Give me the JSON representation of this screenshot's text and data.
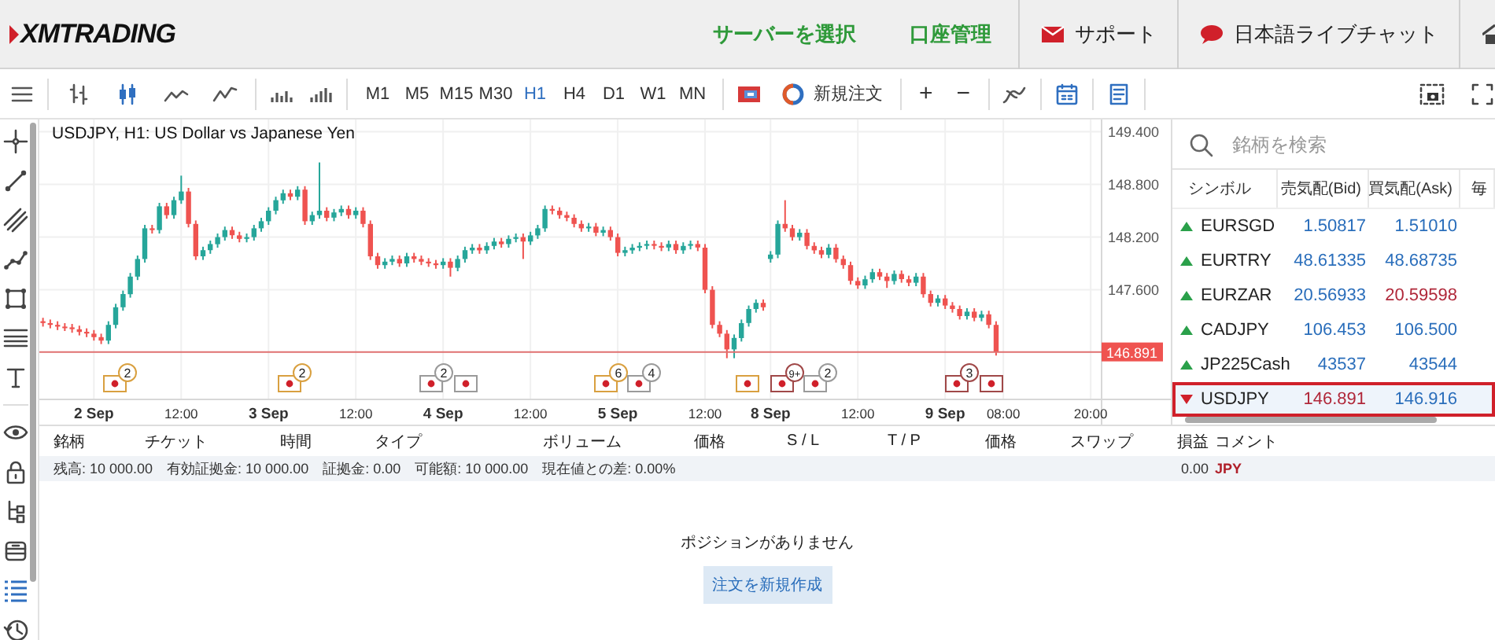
{
  "header": {
    "logo": "XMTRADING",
    "nav": [
      {
        "label": "サーバーを選択",
        "kind": "link"
      },
      {
        "label": "口座管理",
        "kind": "link"
      },
      {
        "label": "サポート",
        "kind": "support"
      },
      {
        "label": "日本語ライブチャット",
        "kind": "chat"
      },
      {
        "kind": "home"
      }
    ]
  },
  "toolbar": {
    "chart_types": [
      {
        "kind": "bars",
        "selected": false
      },
      {
        "kind": "candles",
        "selected": true
      },
      {
        "kind": "line",
        "selected": false
      },
      {
        "kind": "area",
        "selected": false
      }
    ],
    "timeframes": [
      {
        "label": "M1",
        "selected": false
      },
      {
        "label": "M5",
        "selected": false
      },
      {
        "label": "M15",
        "selected": false
      },
      {
        "label": "M30",
        "selected": false
      },
      {
        "label": "H1",
        "selected": true
      },
      {
        "label": "H4",
        "selected": false
      },
      {
        "label": "D1",
        "selected": false
      },
      {
        "label": "W1",
        "selected": false
      },
      {
        "label": "MN",
        "selected": false
      }
    ],
    "new_order": "新規注文",
    "zoom_in": "+",
    "zoom_out": "−"
  },
  "side_tools": [
    {
      "kind": "crosshair",
      "selected": false
    },
    {
      "kind": "line",
      "selected": false
    },
    {
      "kind": "channel",
      "selected": false
    },
    {
      "kind": "polyline",
      "selected": false
    },
    {
      "kind": "shape",
      "selected": false
    },
    {
      "kind": "fibo",
      "selected": false
    },
    {
      "kind": "text",
      "selected": false
    },
    {
      "kind": "eye",
      "selected": false
    },
    {
      "kind": "lock",
      "selected": false
    },
    {
      "kind": "tree",
      "selected": false
    },
    {
      "kind": "stack",
      "selected": false
    },
    {
      "kind": "list",
      "selected": true
    },
    {
      "kind": "history",
      "selected": false
    }
  ],
  "chart": {
    "current_price": "146.891",
    "chart_data": {
      "type": "candlestick",
      "title": "USDJPY, H1: US Dollar vs Japanese Yen",
      "categories": [
        null,
        null,
        null,
        null,
        null,
        null,
        null,
        "2 Sep",
        null,
        null,
        null,
        null,
        null,
        null,
        null,
        null,
        null,
        null,
        null,
        "12:00",
        null,
        null,
        null,
        null,
        null,
        null,
        null,
        null,
        null,
        null,
        null,
        "3 Sep",
        null,
        null,
        null,
        null,
        null,
        null,
        null,
        null,
        null,
        null,
        null,
        "12:00",
        null,
        null,
        null,
        null,
        null,
        null,
        null,
        null,
        null,
        null,
        null,
        "4 Sep",
        null,
        null,
        null,
        null,
        null,
        null,
        null,
        null,
        null,
        null,
        null,
        "12:00",
        null,
        null,
        null,
        null,
        null,
        null,
        null,
        null,
        null,
        null,
        null,
        "5 Sep",
        null,
        null,
        null,
        null,
        null,
        null,
        null,
        null,
        null,
        null,
        null,
        "12:00",
        null,
        null,
        null,
        null,
        null,
        null,
        null,
        null,
        "8 Sep",
        null,
        null,
        null,
        null,
        null,
        null,
        null,
        null,
        null,
        null,
        null,
        "12:00",
        null,
        null,
        null,
        null,
        null,
        null,
        null,
        null,
        null,
        null,
        null,
        "9 Sep",
        null,
        null,
        null,
        null,
        null,
        null,
        null,
        "08:00",
        null,
        null,
        null,
        null,
        null,
        null,
        null,
        null,
        null,
        null,
        null,
        "20:00",
        null
      ],
      "grid": true,
      "ohlc": [
        [
          147.24,
          147.28,
          147.18,
          147.22
        ],
        [
          147.22,
          147.26,
          147.16,
          147.2
        ],
        [
          147.2,
          147.24,
          147.14,
          147.18
        ],
        [
          147.18,
          147.22,
          147.13,
          147.17
        ],
        [
          147.17,
          147.21,
          147.11,
          147.15
        ],
        [
          147.15,
          147.19,
          147.08,
          147.12
        ],
        [
          147.12,
          147.16,
          147.06,
          147.1
        ],
        [
          147.1,
          147.14,
          147.02,
          147.06
        ],
        [
          147.06,
          147.1,
          146.98,
          147.02
        ],
        [
          147.02,
          147.24,
          146.98,
          147.2
        ],
        [
          147.2,
          147.44,
          147.16,
          147.4
        ],
        [
          147.4,
          147.59,
          147.36,
          147.55
        ],
        [
          147.55,
          147.79,
          147.51,
          147.75
        ],
        [
          147.75,
          147.99,
          147.71,
          147.95
        ],
        [
          147.95,
          148.34,
          147.91,
          148.3
        ],
        [
          148.3,
          148.34,
          148.24,
          148.28
        ],
        [
          148.28,
          148.59,
          148.24,
          148.55
        ],
        [
          148.55,
          148.59,
          148.41,
          148.45
        ],
        [
          148.45,
          148.66,
          148.41,
          148.62
        ],
        [
          148.62,
          148.9,
          148.58,
          148.72
        ],
        [
          148.72,
          148.76,
          148.31,
          148.35
        ],
        [
          148.35,
          148.39,
          147.94,
          147.98
        ],
        [
          147.98,
          148.09,
          147.94,
          148.05
        ],
        [
          148.05,
          148.16,
          148.01,
          148.12
        ],
        [
          148.12,
          148.24,
          148.08,
          148.2
        ],
        [
          148.2,
          148.32,
          148.16,
          148.28
        ],
        [
          148.28,
          148.32,
          148.18,
          148.22
        ],
        [
          148.22,
          148.26,
          148.14,
          148.18
        ],
        [
          148.18,
          148.24,
          148.14,
          148.2
        ],
        [
          148.2,
          148.34,
          148.16,
          148.3
        ],
        [
          148.3,
          148.42,
          148.26,
          148.38
        ],
        [
          148.38,
          148.54,
          148.34,
          148.5
        ],
        [
          148.5,
          148.66,
          148.46,
          148.62
        ],
        [
          148.62,
          148.74,
          148.58,
          148.7
        ],
        [
          148.7,
          148.74,
          148.62,
          148.66
        ],
        [
          148.66,
          148.78,
          148.62,
          148.74
        ],
        [
          148.74,
          148.78,
          148.34,
          148.38
        ],
        [
          148.38,
          148.49,
          148.34,
          148.45
        ],
        [
          148.45,
          149.05,
          148.41,
          148.5
        ],
        [
          148.5,
          148.54,
          148.38,
          148.42
        ],
        [
          148.42,
          148.52,
          148.38,
          148.48
        ],
        [
          148.48,
          148.56,
          148.44,
          148.52
        ],
        [
          148.52,
          148.56,
          148.41,
          148.45
        ],
        [
          148.45,
          148.54,
          148.41,
          148.5
        ],
        [
          148.5,
          148.54,
          148.31,
          148.35
        ],
        [
          148.35,
          148.39,
          147.94,
          147.98
        ],
        [
          147.98,
          148.02,
          147.84,
          147.88
        ],
        [
          147.88,
          147.96,
          147.84,
          147.92
        ],
        [
          147.92,
          147.99,
          147.88,
          147.95
        ],
        [
          147.95,
          147.99,
          147.86,
          147.9
        ],
        [
          147.9,
          148.02,
          147.86,
          147.98
        ],
        [
          147.98,
          148.02,
          147.91,
          147.95
        ],
        [
          147.95,
          147.99,
          147.88,
          147.92
        ],
        [
          147.92,
          147.96,
          147.86,
          147.9
        ],
        [
          147.9,
          147.94,
          147.84,
          147.88
        ],
        [
          147.88,
          147.96,
          147.84,
          147.92
        ],
        [
          147.92,
          147.96,
          147.75,
          147.85
        ],
        [
          147.85,
          147.99,
          147.81,
          147.95
        ],
        [
          147.95,
          148.09,
          147.91,
          148.05
        ],
        [
          148.05,
          148.12,
          148.01,
          148.08
        ],
        [
          148.08,
          148.12,
          148.01,
          148.05
        ],
        [
          148.05,
          148.14,
          148.01,
          148.1
        ],
        [
          148.1,
          148.19,
          148.06,
          148.15
        ],
        [
          148.15,
          148.19,
          148.08,
          148.12
        ],
        [
          148.12,
          148.22,
          148.08,
          148.18
        ],
        [
          148.18,
          148.24,
          148.14,
          148.2
        ],
        [
          148.2,
          148.24,
          147.95,
          148.15
        ],
        [
          148.15,
          148.26,
          148.11,
          148.22
        ],
        [
          148.22,
          148.34,
          148.18,
          148.3
        ],
        [
          148.3,
          148.56,
          148.26,
          148.52
        ],
        [
          148.52,
          148.56,
          148.46,
          148.5
        ],
        [
          148.5,
          148.54,
          148.41,
          148.45
        ],
        [
          148.45,
          148.49,
          148.38,
          148.42
        ],
        [
          148.42,
          148.46,
          148.31,
          148.35
        ],
        [
          148.35,
          148.39,
          148.26,
          148.3
        ],
        [
          148.3,
          148.36,
          148.26,
          148.32
        ],
        [
          148.32,
          148.36,
          148.21,
          148.25
        ],
        [
          148.25,
          148.32,
          148.21,
          148.28
        ],
        [
          148.28,
          148.32,
          148.16,
          148.2
        ],
        [
          148.2,
          148.24,
          147.98,
          148.02
        ],
        [
          148.02,
          148.09,
          147.98,
          148.05
        ],
        [
          148.05,
          148.12,
          148.01,
          148.08
        ],
        [
          148.08,
          148.14,
          148.04,
          148.1
        ],
        [
          148.1,
          148.16,
          148.06,
          148.12
        ],
        [
          148.12,
          148.16,
          148.06,
          148.1
        ],
        [
          148.1,
          148.14,
          148.04,
          148.08
        ],
        [
          148.08,
          148.16,
          148.04,
          148.12
        ],
        [
          148.12,
          148.16,
          148.01,
          148.05
        ],
        [
          148.05,
          148.14,
          148.01,
          148.1
        ],
        [
          148.1,
          148.16,
          148.06,
          148.12
        ],
        [
          148.12,
          148.16,
          148.04,
          148.08
        ],
        [
          148.08,
          148.12,
          147.56,
          147.6
        ],
        [
          147.6,
          147.64,
          147.16,
          147.2
        ],
        [
          147.2,
          147.24,
          147.06,
          147.1
        ],
        [
          147.1,
          147.14,
          146.82,
          146.92
        ],
        [
          146.92,
          147.09,
          146.82,
          147.05
        ],
        [
          147.05,
          147.26,
          147.01,
          147.22
        ],
        [
          147.22,
          147.42,
          147.18,
          147.38
        ],
        [
          147.38,
          147.49,
          147.34,
          147.45
        ],
        [
          147.45,
          147.49,
          147.36,
          147.4
        ],
        [
          147.95,
          148.04,
          147.91,
          148.0
        ],
        [
          148.0,
          148.39,
          147.96,
          148.35
        ],
        [
          148.35,
          148.62,
          148.26,
          148.3
        ],
        [
          148.3,
          148.34,
          148.16,
          148.2
        ],
        [
          148.2,
          148.29,
          148.16,
          148.25
        ],
        [
          148.25,
          148.29,
          148.06,
          148.1
        ],
        [
          148.1,
          148.14,
          148.01,
          148.05
        ],
        [
          148.05,
          148.09,
          147.96,
          148.0
        ],
        [
          148.0,
          148.12,
          147.96,
          148.08
        ],
        [
          148.08,
          148.12,
          147.91,
          147.95
        ],
        [
          147.95,
          147.99,
          147.84,
          147.88
        ],
        [
          147.88,
          147.92,
          147.66,
          147.7
        ],
        [
          147.7,
          147.74,
          147.61,
          147.65
        ],
        [
          147.65,
          147.76,
          147.61,
          147.72
        ],
        [
          147.72,
          147.84,
          147.68,
          147.8
        ],
        [
          147.8,
          147.84,
          147.71,
          147.75
        ],
        [
          147.75,
          147.79,
          147.62,
          147.7
        ],
        [
          147.7,
          147.82,
          147.66,
          147.78
        ],
        [
          147.78,
          147.82,
          147.68,
          147.72
        ],
        [
          147.72,
          147.76,
          147.64,
          147.68
        ],
        [
          147.68,
          147.79,
          147.64,
          147.75
        ],
        [
          147.75,
          147.79,
          147.51,
          147.55
        ],
        [
          147.55,
          147.59,
          147.41,
          147.45
        ],
        [
          147.45,
          147.54,
          147.41,
          147.5
        ],
        [
          147.5,
          147.54,
          147.38,
          147.42
        ],
        [
          147.42,
          147.46,
          147.34,
          147.38
        ],
        [
          147.38,
          147.42,
          147.26,
          147.3
        ],
        [
          147.3,
          147.39,
          147.26,
          147.35
        ],
        [
          147.35,
          147.39,
          147.24,
          147.28
        ],
        [
          147.28,
          147.36,
          147.24,
          147.32
        ],
        [
          147.32,
          147.36,
          147.16,
          147.2
        ],
        [
          147.2,
          147.24,
          146.85,
          146.89
        ],
        null,
        null,
        null,
        null,
        null,
        null,
        null,
        null,
        null,
        null,
        null,
        null,
        null,
        null
      ],
      "ylim": [
        146.35,
        149.54
      ],
      "yticks": [
        {
          "value": 149.4,
          "label": "149.400"
        },
        {
          "value": 148.8,
          "label": "148.800"
        },
        {
          "value": 148.2,
          "label": "148.200"
        },
        {
          "value": 147.6,
          "label": "147.600"
        }
      ]
    },
    "day_ticks": [
      true,
      false,
      true,
      false,
      true,
      false,
      true,
      false,
      true,
      false,
      true,
      false,
      false
    ],
    "events": [
      {
        "badge": "2",
        "color": "#d9a040"
      },
      {
        "badge": "2",
        "color": "#d9a040"
      },
      {
        "badge": "2",
        "color": "#9a9a9a"
      },
      {
        "color": "#9a9a9a"
      },
      {
        "badge": "6",
        "color": "#d9a040"
      },
      {
        "badge": "4",
        "color": "#9a9a9a"
      },
      {
        "color": "#d9a040"
      },
      {
        "badge": "9+",
        "color": "#a04848"
      },
      {
        "badge": "2",
        "color": "#9a9a9a"
      },
      {
        "badge": "3",
        "color": "#a04848"
      },
      {
        "color": "#a04848"
      }
    ]
  },
  "watchlist": {
    "search": {
      "placeholder": "銘柄を検索"
    },
    "columns": [
      "シンボル",
      "売気配(Bid)",
      "買気配(Ask)",
      "毎"
    ],
    "rows": [
      {
        "symbol": "EURSGD",
        "falling": false,
        "bid": "1.50817",
        "ask": "1.51010",
        "bid_down": false,
        "ask_down": false,
        "selected": false
      },
      {
        "symbol": "EURTRY",
        "falling": false,
        "bid": "48.61335",
        "ask": "48.68735",
        "bid_down": false,
        "ask_down": false,
        "selected": false
      },
      {
        "symbol": "EURZAR",
        "falling": false,
        "bid": "20.56933",
        "ask": "20.59598",
        "bid_down": false,
        "ask_down": true,
        "selected": false
      },
      {
        "symbol": "CADJPY",
        "falling": false,
        "bid": "106.453",
        "ask": "106.500",
        "bid_down": false,
        "ask_down": false,
        "selected": false
      },
      {
        "symbol": "JP225Cash",
        "falling": false,
        "bid": "43537",
        "ask": "43544",
        "bid_down": false,
        "ask_down": false,
        "selected": false
      },
      {
        "symbol": "USDJPY",
        "falling": true,
        "bid": "146.891",
        "ask": "146.916",
        "bid_down": true,
        "ask_down": false,
        "selected": true
      }
    ]
  },
  "positions": {
    "columns": [
      "銘柄",
      "チケット",
      "時間",
      "タイプ",
      "ボリューム",
      "価格",
      "S / L",
      "T / P",
      "価格",
      "スワップ",
      "損益",
      "コメント"
    ],
    "summary": [
      "残高: 10 000.00",
      "有効証拠金: 10 000.00",
      "証拠金: 0.00",
      "可能額: 10 000.00",
      "現在値との差: 0.00%"
    ],
    "profit": "0.00",
    "currency": "JPY",
    "empty_message": "ポジションがありません",
    "create_button": "注文を新規作成"
  }
}
